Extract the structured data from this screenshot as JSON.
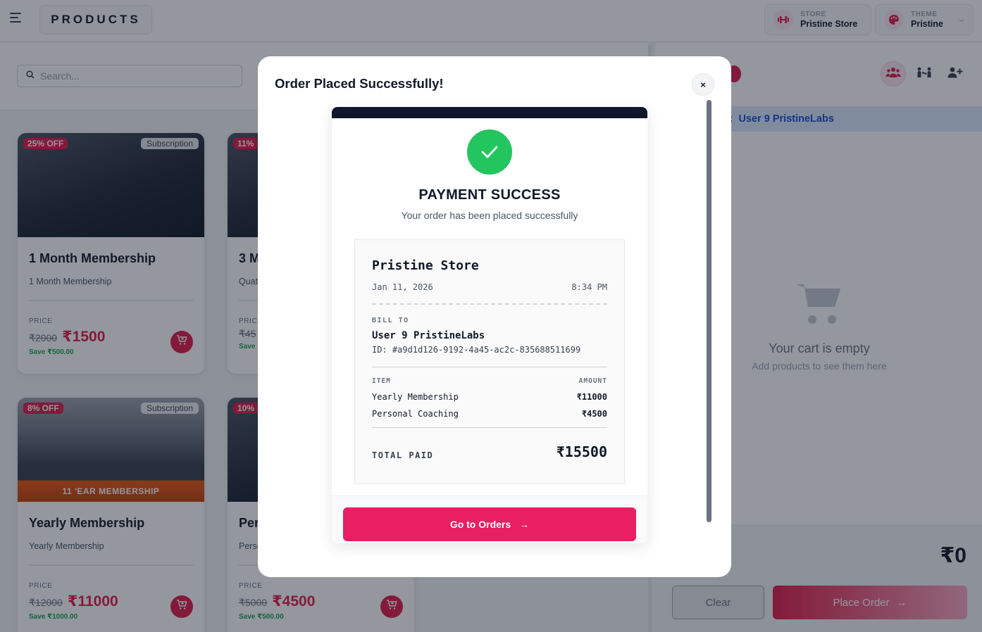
{
  "header": {
    "title": "PRODUCTS",
    "store": {
      "caption": "STORE",
      "value": "Pristine Store",
      "icon": "dumbbell-icon"
    },
    "theme": {
      "caption": "THEME",
      "value": "Pristine",
      "icon": "palette-icon"
    }
  },
  "search": {
    "placeholder": "Search..."
  },
  "products": [
    {
      "name": "1 Month Membership",
      "description": "1 Month Membership",
      "badge_off": "25% OFF",
      "badge_type": "Subscription",
      "price_caption": "PRICE",
      "old_price": "₹2000",
      "new_price": "₹1500",
      "save": "Save ₹500.00"
    },
    {
      "name": "3 M",
      "description": "Quat",
      "badge_off": "11%",
      "badge_type": "",
      "price_caption": "PRIC",
      "old_price": "₹45",
      "new_price": "",
      "save": "Save"
    },
    {
      "name": "Yearly Membership",
      "description": "Yearly Membership",
      "badge_off": "8% OFF",
      "badge_type": "Subscription",
      "banner_text": "11 'EAR MEMBERSHIP",
      "price_caption": "PRICE",
      "old_price": "₹12000",
      "new_price": "₹11000",
      "save": "Save ₹1000.00"
    },
    {
      "name": "Per",
      "description": "Perso",
      "badge_off": "10%",
      "badge_type": "",
      "price_caption": "PRICE",
      "old_price": "₹5000",
      "new_price": "₹4500",
      "save": "Save ₹500.00"
    }
  ],
  "cart": {
    "customer_label": "r:",
    "customer_name": "User 9 PristineLabs",
    "empty_title": "Your cart is empty",
    "empty_sub": "Add products to see them here",
    "total_label": "t",
    "total_value": "₹0",
    "clear_label": "Clear",
    "place_order_label": "Place Order"
  },
  "modal": {
    "title": "Order Placed Successfully!",
    "close_label": "×",
    "success_title": "PAYMENT SUCCESS",
    "success_sub": "Your order has been placed successfully",
    "receipt": {
      "store": "Pristine Store",
      "date": "Jan 11, 2026",
      "time": "8:34 PM",
      "bill_to_label": "BILL TO",
      "customer": "User 9 PristineLabs",
      "customer_id": "ID: #a9d1d126-9192-4a45-ac2c-835688511699",
      "item_header": "ITEM",
      "amount_header": "AMOUNT",
      "items": [
        {
          "name": "Yearly Membership",
          "amount": "₹11000"
        },
        {
          "name": "Personal Coaching",
          "amount": "₹4500"
        }
      ],
      "total_label": "TOTAL PAID",
      "total_value": "₹15500"
    },
    "go_orders_label": "Go to Orders"
  },
  "colors": {
    "accent": "#e91e63",
    "success": "#22c55e",
    "dark_band": "#0f172a"
  }
}
